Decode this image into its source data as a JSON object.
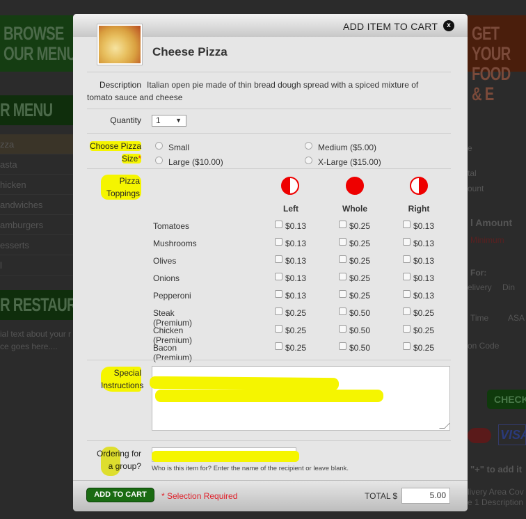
{
  "background": {
    "banner_left": [
      "BROWSE",
      "OUR MENU"
    ],
    "banner_right": [
      "GET YOUR",
      "FOOD & E"
    ],
    "menu_heading": "R MENU",
    "menu_items": [
      "zza",
      "asta",
      "hicken",
      "andwiches",
      "amburgers",
      "esserts",
      "l"
    ],
    "restaurant_heading": "R RESTAURANT",
    "restaurant_text": [
      "ial text about your r",
      "ce goes here...."
    ],
    "right_texts": [
      "e",
      "tal",
      "ount",
      "l Amount",
      "Minimum",
      "For:",
      "elivery",
      "Din",
      "Time",
      "ASA",
      "on Code",
      "CHECK",
      "\"+\" to add it",
      "livery Area Cov",
      "e 1 Description"
    ]
  },
  "modal": {
    "title": "ADD ITEM TO CART",
    "close_label": "x",
    "item_name": "Cheese Pizza",
    "description_label": "Description",
    "description": "Italian open pie made of thin bread dough spread with a spiced mixture of tomato sauce and cheese",
    "quantity_label": "Quantity",
    "quantity_value": "1",
    "size_label": [
      "Choose Pizza",
      "Size"
    ],
    "required_mark": "*",
    "sizes": [
      "Small",
      "Medium ($5.00)",
      "Large ($10.00)",
      "X-Large ($15.00)"
    ],
    "toppings_label": [
      "Pizza",
      "Toppings"
    ],
    "topping_columns": [
      "Left",
      "Whole",
      "Right"
    ],
    "toppings": [
      {
        "name": "Tomatoes",
        "left": "$0.13",
        "whole": "$0.25",
        "right": "$0.13"
      },
      {
        "name": "Mushrooms",
        "left": "$0.13",
        "whole": "$0.25",
        "right": "$0.13"
      },
      {
        "name": "Olives",
        "left": "$0.13",
        "whole": "$0.25",
        "right": "$0.13"
      },
      {
        "name": "Onions",
        "left": "$0.13",
        "whole": "$0.25",
        "right": "$0.13"
      },
      {
        "name": "Pepperoni",
        "left": "$0.13",
        "whole": "$0.25",
        "right": "$0.13"
      },
      {
        "name": "Steak (Premium)",
        "left": "$0.25",
        "whole": "$0.50",
        "right": "$0.25"
      },
      {
        "name": "Chicken (Premium)",
        "left": "$0.25",
        "whole": "$0.50",
        "right": "$0.25"
      },
      {
        "name": "Bacon (Premium)",
        "left": "$0.25",
        "whole": "$0.50",
        "right": "$0.25"
      }
    ],
    "special_label": [
      "Special",
      "Instructions"
    ],
    "group_label": [
      "Ordering for",
      "a group?"
    ],
    "group_hint": "Who is this item for? Enter the name of the recipient or leave blank.",
    "add_button": "ADD TO CART",
    "selection_required": "* Selection Required",
    "total_label": "TOTAL $",
    "total_value": "5.00"
  },
  "colors": {
    "accent_green": "#1a6b12",
    "required_red": "#e0202a",
    "topping_red": "#ee0000",
    "highlight": "#f5f500"
  }
}
